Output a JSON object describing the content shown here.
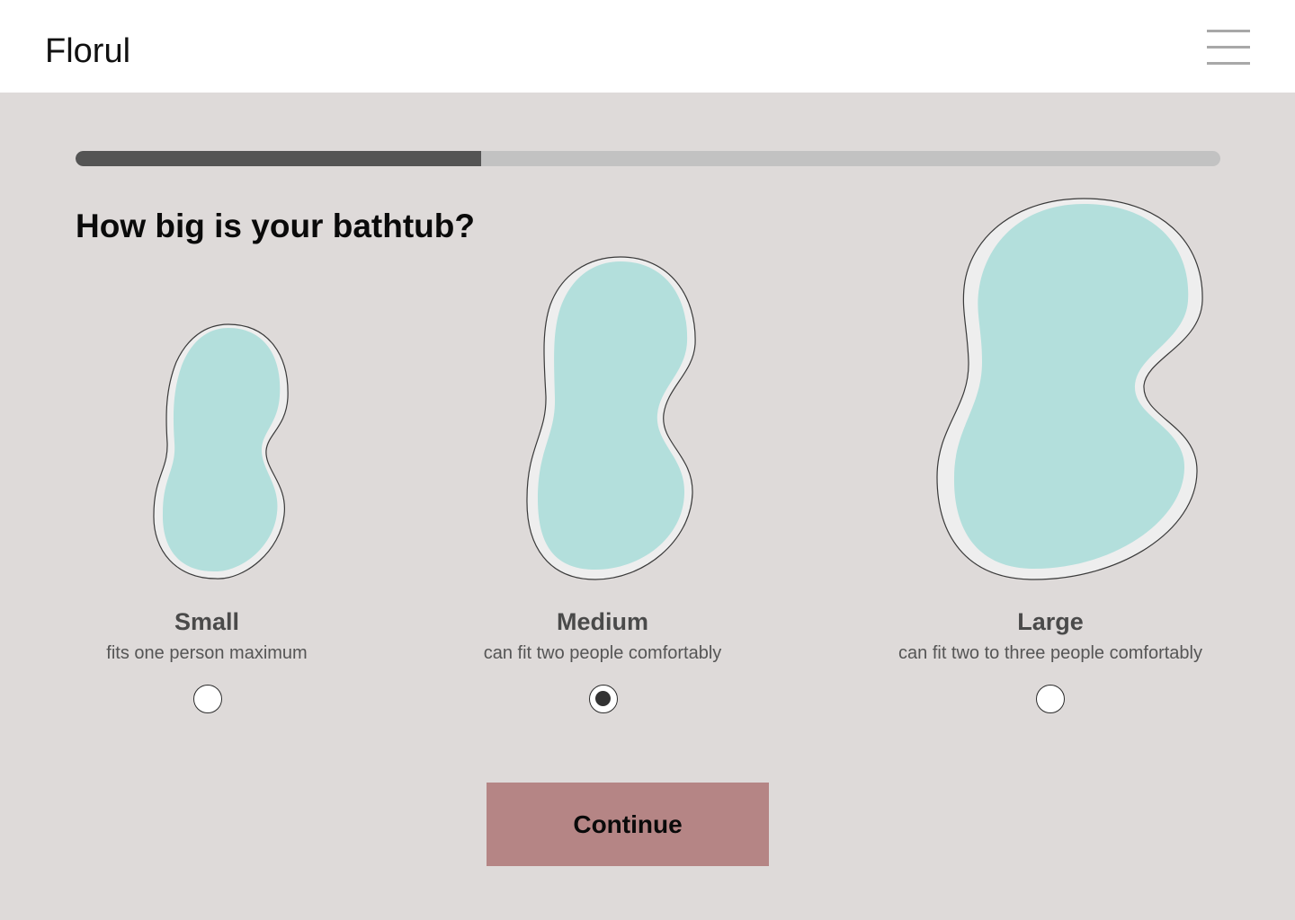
{
  "header": {
    "brand": "Florul",
    "menu_icon": "hamburger-menu-icon"
  },
  "progress": {
    "fraction": 0.354
  },
  "question": {
    "title": "How big is your bathtub?"
  },
  "options": [
    {
      "title": "Small",
      "description": "fits one person maximum",
      "selected": false
    },
    {
      "title": "Medium",
      "description": "can fit two people comfortably",
      "selected": true
    },
    {
      "title": "Large",
      "description": "can fit two to three people comfortably",
      "selected": false
    }
  ],
  "actions": {
    "continue_label": "Continue"
  },
  "colors": {
    "background": "#dedad9",
    "header_bg": "#ffffff",
    "water": "#b3dfdc",
    "tub_rim": "#eeeeee",
    "progress_fill": "#545454",
    "progress_track": "#c2c2c2",
    "button_bg": "#b58585"
  }
}
